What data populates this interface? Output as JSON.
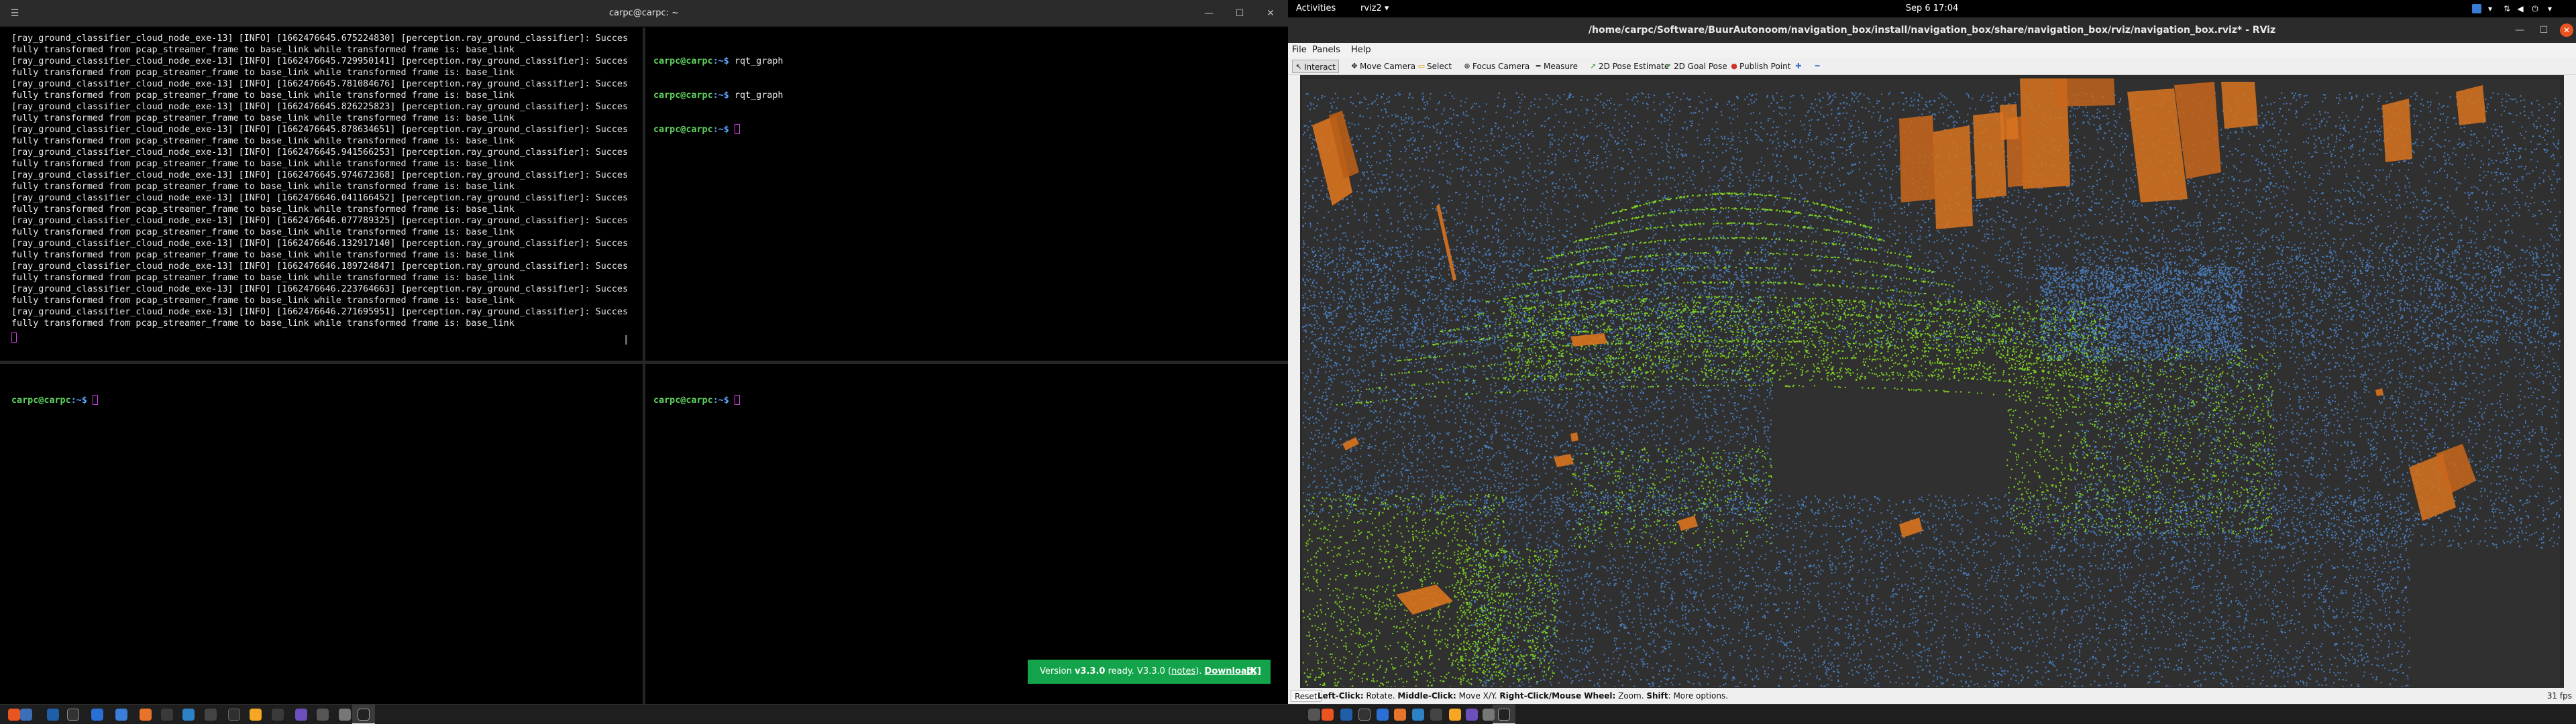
{
  "terminal": {
    "title": "carpc@carpc: ~",
    "log_lines": [
      "[ray_ground_classifier_cloud_node_exe-13] [INFO] [1662476645.675224830] [perception.ray_ground_classifier]: Succes",
      "fully transformed from pcap_streamer_frame to base_link while transformed frame is: base_link",
      "[ray_ground_classifier_cloud_node_exe-13] [INFO] [1662476645.729950141] [perception.ray_ground_classifier]: Succes",
      "fully transformed from pcap_streamer_frame to base_link while transformed frame is: base_link",
      "[ray_ground_classifier_cloud_node_exe-13] [INFO] [1662476645.781084676] [perception.ray_ground_classifier]: Succes",
      "fully transformed from pcap_streamer_frame to base_link while transformed frame is: base_link",
      "[ray_ground_classifier_cloud_node_exe-13] [INFO] [1662476645.826225823] [perception.ray_ground_classifier]: Succes",
      "fully transformed from pcap_streamer_frame to base_link while transformed frame is: base_link",
      "[ray_ground_classifier_cloud_node_exe-13] [INFO] [1662476645.878634651] [perception.ray_ground_classifier]: Succes",
      "fully transformed from pcap_streamer_frame to base_link while transformed frame is: base_link",
      "[ray_ground_classifier_cloud_node_exe-13] [INFO] [1662476645.941566253] [perception.ray_ground_classifier]: Succes",
      "fully transformed from pcap_streamer_frame to base_link while transformed frame is: base_link",
      "[ray_ground_classifier_cloud_node_exe-13] [INFO] [1662476645.974672368] [perception.ray_ground_classifier]: Succes",
      "fully transformed from pcap_streamer_frame to base_link while transformed frame is: base_link",
      "[ray_ground_classifier_cloud_node_exe-13] [INFO] [1662476646.041166452] [perception.ray_ground_classifier]: Succes",
      "fully transformed from pcap_streamer_frame to base_link while transformed frame is: base_link",
      "[ray_ground_classifier_cloud_node_exe-13] [INFO] [1662476646.077789325] [perception.ray_ground_classifier]: Succes",
      "fully transformed from pcap_streamer_frame to base_link while transformed frame is: base_link",
      "[ray_ground_classifier_cloud_node_exe-13] [INFO] [1662476646.132917140] [perception.ray_ground_classifier]: Succes",
      "fully transformed from pcap_streamer_frame to base_link while transformed frame is: base_link",
      "[ray_ground_classifier_cloud_node_exe-13] [INFO] [1662476646.189724847] [perception.ray_ground_classifier]: Succes",
      "fully transformed from pcap_streamer_frame to base_link while transformed frame is: base_link",
      "[ray_ground_classifier_cloud_node_exe-13] [INFO] [1662476646.223764663] [perception.ray_ground_classifier]: Succes",
      "fully transformed from pcap_streamer_frame to base_link while transformed frame is: base_link",
      "[ray_ground_classifier_cloud_node_exe-13] [INFO] [1662476646.271695951] [perception.ray_ground_classifier]: Succes",
      "fully transformed from pcap_streamer_frame to base_link while transformed frame is: base_link"
    ],
    "prompt_user": "carpc@carpc",
    "prompt_path": ":~$ ",
    "tr_commands": [
      "rqt_graph",
      "rqt_graph",
      ""
    ],
    "update_toast": {
      "prefix": "Version ",
      "version": "v3.3.0",
      "mid": " ready. V3.3.0 (",
      "notes": "notes",
      "after": "). ",
      "download": "Download.",
      "close": "[X]"
    }
  },
  "gnome": {
    "activities": "Activities",
    "app_name": "rviz2 ▾",
    "clock": "Sep 6  17:04"
  },
  "rviz": {
    "title": "/home/carpc/Software/BuurAutonoom/navigation_box/install/navigation_box/share/navigation_box/rviz/navigation_box.rviz* - RViz",
    "menu": [
      "File",
      "Panels",
      "Help"
    ],
    "tools": [
      "Interact",
      "Move Camera",
      "Select",
      "Focus Camera",
      "Measure",
      "2D Pose Estimate",
      "2D Goal Pose",
      "Publish Point"
    ],
    "reset": "Reset",
    "hint": {
      "l1": "Left-Click:",
      "v1": " Rotate. ",
      "l2": "Middle-Click:",
      "v2": " Move X/Y. ",
      "l3": "Right-Click/Mouse Wheel:",
      "v3": " Zoom. ",
      "l4": "Shift",
      "v4": ": More options."
    },
    "fps": "31 fps",
    "colors": {
      "ground": "#7ed321",
      "nonground": "#4a7fc1",
      "boxes": "#d9731f",
      "background": "#303030"
    }
  }
}
